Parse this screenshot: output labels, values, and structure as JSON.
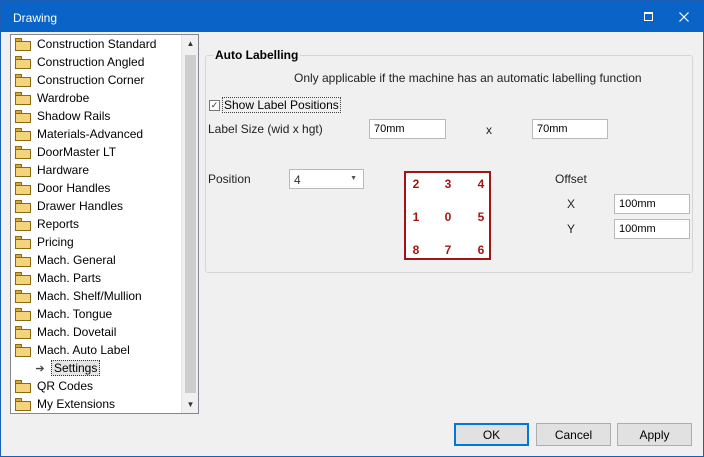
{
  "window": {
    "title": "Drawing"
  },
  "tree": {
    "items": [
      {
        "label": "Construction Standard"
      },
      {
        "label": "Construction Angled"
      },
      {
        "label": "Construction Corner"
      },
      {
        "label": "Wardrobe"
      },
      {
        "label": "Shadow Rails"
      },
      {
        "label": "Materials-Advanced"
      },
      {
        "label": "DoorMaster LT"
      },
      {
        "label": "Hardware"
      },
      {
        "label": "Door Handles"
      },
      {
        "label": "Drawer Handles"
      },
      {
        "label": "Reports"
      },
      {
        "label": "Pricing"
      },
      {
        "label": "Mach. General"
      },
      {
        "label": "Mach. Parts"
      },
      {
        "label": "Mach. Shelf/Mullion"
      },
      {
        "label": "Mach. Tongue"
      },
      {
        "label": "Mach. Dovetail"
      },
      {
        "label": "Mach. Auto Label"
      },
      {
        "label": "Settings",
        "selected": true,
        "child": true
      },
      {
        "label": "QR Codes"
      },
      {
        "label": "My Extensions"
      }
    ]
  },
  "group": {
    "title": "Auto Labelling",
    "note": "Only applicable if the machine has an automatic labelling function",
    "show_positions_label": "Show Label Positions",
    "show_positions_checked": true,
    "label_size_label": "Label Size (wid x hgt)",
    "width_value": "70mm",
    "x_separator": "x",
    "height_value": "70mm",
    "position_label": "Position",
    "position_value": "4",
    "offset_label": "Offset",
    "offset_x_label": "X",
    "offset_x_value": "100mm",
    "offset_y_label": "Y",
    "offset_y_value": "100mm",
    "position_grid": [
      [
        "2",
        "3",
        "4"
      ],
      [
        "1",
        "0",
        "5"
      ],
      [
        "8",
        "7",
        "6"
      ]
    ]
  },
  "buttons": {
    "ok": "OK",
    "cancel": "Cancel",
    "apply": "Apply"
  },
  "colors": {
    "titlebar": "#0a64c8",
    "grid_accent": "#a31515"
  }
}
